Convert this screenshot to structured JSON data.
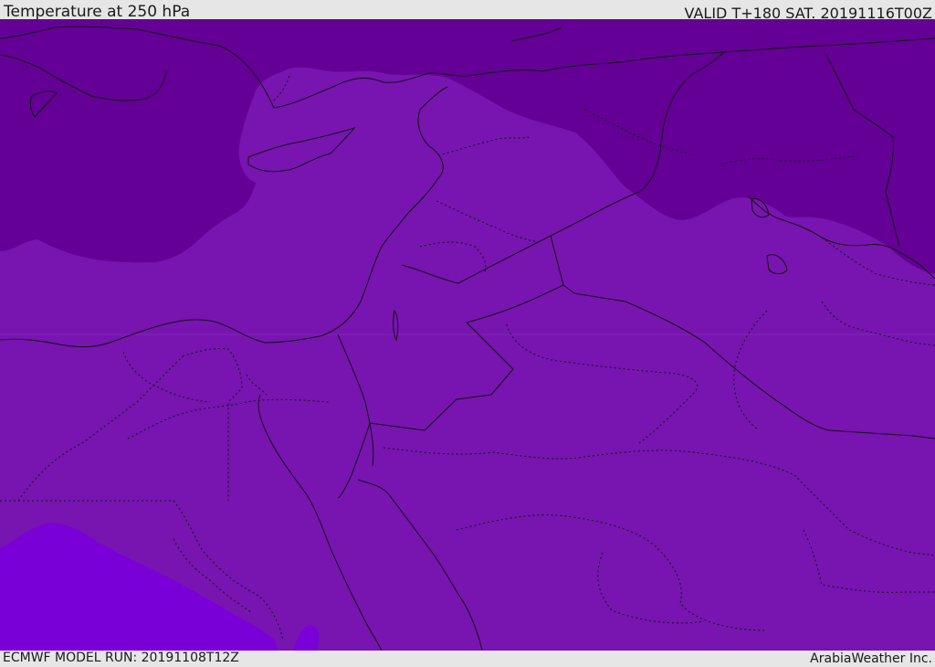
{
  "header": {
    "title": "Temperature at 250 hPa",
    "valid": "VALID T+180 SAT. 20191116T00Z"
  },
  "footer": {
    "model_run": "ECMWF MODEL RUN: 20191108T12Z",
    "credit": "ArabiaWeather Inc."
  },
  "colors": {
    "cold_band": "#640096",
    "mid_band": "#7814b0",
    "warm_band": "#7a00d8",
    "border_line": "#111111",
    "bar_bg": "#e6e6e6"
  }
}
